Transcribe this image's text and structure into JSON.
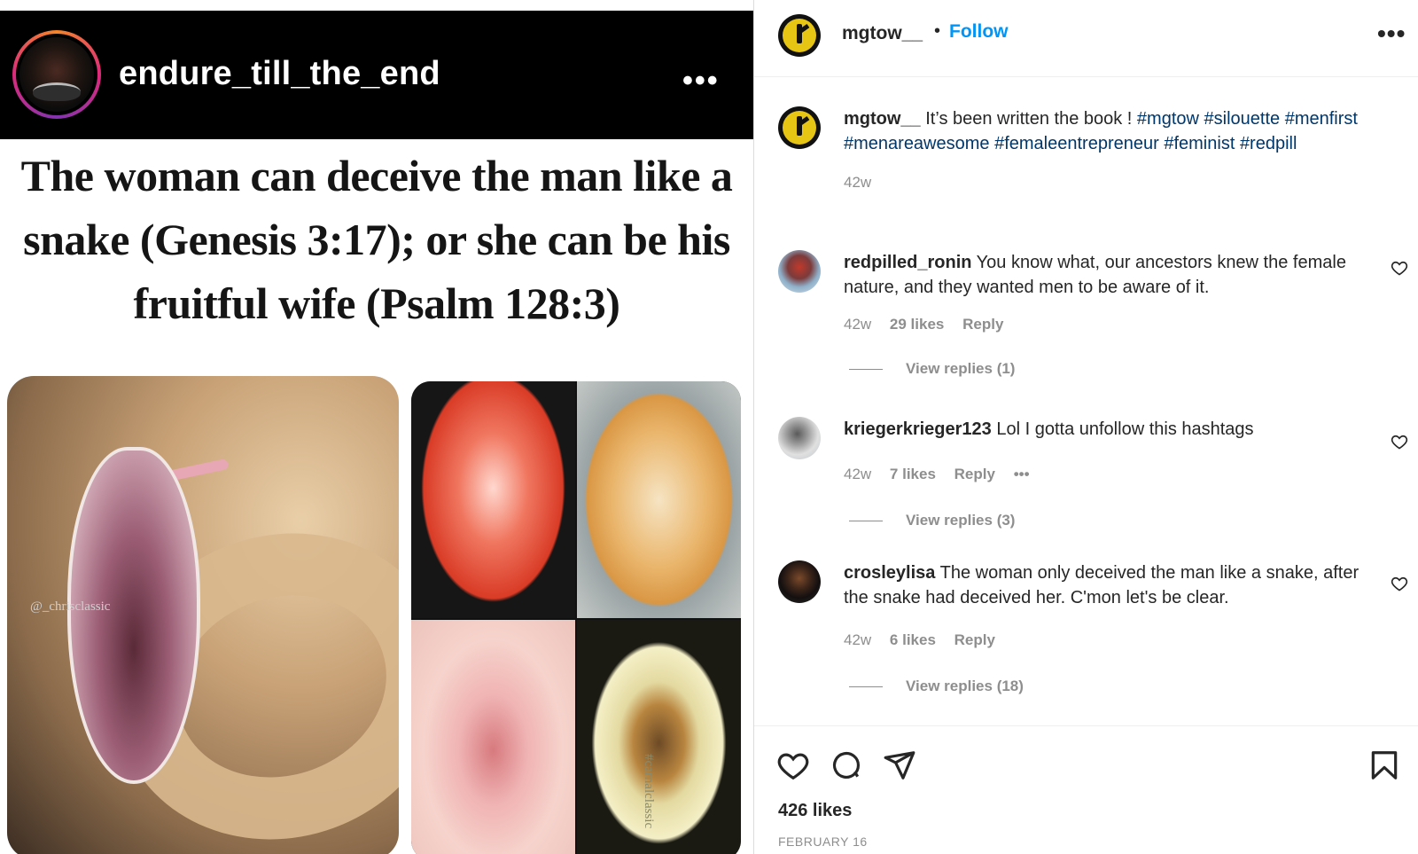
{
  "post": {
    "author": "endure_till_the_end",
    "meme_text": "The woman can deceive the man like a snake (Genesis 3:17); or she can be his fruitful wife (Psalm 128:3)",
    "watermark_left": "@_chrisclassic",
    "watermark_right": "#carnalclassic"
  },
  "sidebar": {
    "header": {
      "username": "mgtow__",
      "separator": "•",
      "follow_label": "Follow",
      "more_label": "..."
    },
    "caption": {
      "username": "mgtow__",
      "text": "It’s been written the book !",
      "hashtags": [
        "#mgtow",
        "#silouette",
        "#menfirst",
        "#menareawesome",
        "#femaleentrepreneur",
        "#feminist",
        "#redpill"
      ],
      "time": "42w"
    },
    "comments": [
      {
        "username": "redpilled_ronin",
        "text": "You know what, our ancestors knew the female nature, and they wanted men to be aware of it.",
        "time": "42w",
        "likes": "29 likes",
        "reply": "Reply",
        "view_replies": "View replies (1)"
      },
      {
        "username": "kriegerkrieger123",
        "text": "Lol I gotta unfollow this hashtags",
        "time": "42w",
        "likes": "7 likes",
        "reply": "Reply",
        "more": "•••",
        "view_replies": "View replies (3)"
      },
      {
        "username": "crosleylisa",
        "text": "The woman only deceived the man like a snake, after the snake had deceived her. C'mon let's be clear.",
        "time": "42w",
        "likes": "6 likes",
        "reply": "Reply",
        "view_replies": "View replies (18)"
      }
    ],
    "footer": {
      "likes": "426 likes",
      "date": "FEBRUARY 16"
    }
  },
  "colors": {
    "link_blue": "#0095f6",
    "hashtag_blue": "#00376b",
    "muted_gray": "#8e8e8e",
    "text_dark": "#262626"
  },
  "icons": [
    "heart-icon",
    "comment-icon",
    "share-icon",
    "bookmark-icon",
    "more-icon"
  ]
}
